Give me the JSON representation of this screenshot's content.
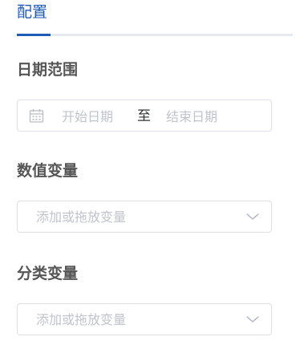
{
  "tabs": {
    "active_label": "配置"
  },
  "date_range": {
    "title": "日期范围",
    "start_placeholder": "开始日期",
    "separator": "至",
    "end_placeholder": "结束日期",
    "icon": "calendar-icon"
  },
  "numeric_variable": {
    "title": "数值变量",
    "placeholder": "添加或拖放变量",
    "icon": "chevron-down-icon"
  },
  "categorical_variable": {
    "title": "分类变量",
    "placeholder": "添加或拖放变量",
    "icon": "chevron-down-icon"
  },
  "colors": {
    "accent": "#1f5bb8",
    "title_text": "#555555",
    "placeholder": "#c0c4cc",
    "border": "#dcdfe6"
  }
}
